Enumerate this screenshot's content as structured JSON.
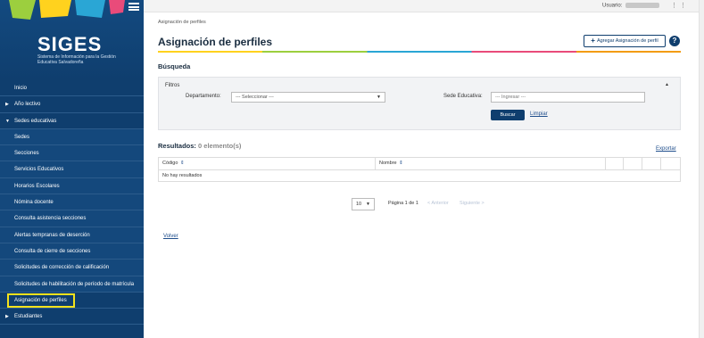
{
  "sidebar": {
    "logo_title": "SIGES",
    "logo_subtitle": "Sistema de Información para la Gestión Educativa Salvadoreña",
    "items": [
      {
        "label": "Inicio",
        "kind": "section",
        "arrow": ""
      },
      {
        "label": "Año lectivo",
        "kind": "section",
        "arrow": "▶"
      },
      {
        "label": "Sedes educativas",
        "kind": "section",
        "arrow": "▼"
      },
      {
        "label": "Sedes",
        "kind": "sub",
        "arrow": ""
      },
      {
        "label": "Secciones",
        "kind": "sub",
        "arrow": ""
      },
      {
        "label": "Servicios Educativos",
        "kind": "sub",
        "arrow": ""
      },
      {
        "label": "Horarios Escolares",
        "kind": "sub",
        "arrow": ""
      },
      {
        "label": "Nómina docente",
        "kind": "sub",
        "arrow": ""
      },
      {
        "label": "Consulta asistencia secciones",
        "kind": "sub",
        "arrow": ""
      },
      {
        "label": "Alertas tempranas de deserción",
        "kind": "sub",
        "arrow": ""
      },
      {
        "label": "Consulta de cierre de secciones",
        "kind": "sub",
        "arrow": ""
      },
      {
        "label": "Solicitudes de corrección de calificación",
        "kind": "sub",
        "arrow": ""
      },
      {
        "label": "Solicitudes de habilitación de período de matrícula",
        "kind": "sub",
        "arrow": ""
      },
      {
        "label": "Asignación de perfiles",
        "kind": "active",
        "arrow": ""
      },
      {
        "label": "Estudiantes",
        "kind": "section",
        "arrow": "▶"
      }
    ]
  },
  "topbar": {
    "user_label": "Usuario:",
    "menu_dots": "⋮"
  },
  "breadcrumb": "Asignación de perfiles",
  "page_title": "Asignación de perfiles",
  "add_button": {
    "icon": "+",
    "label": "Agregar Asignación de perfil"
  },
  "help_label": "?",
  "search": {
    "title": "Búsqueda",
    "filters_title": "Filtros",
    "collapse_caret": "▲",
    "department_label": "Departamento:",
    "department_value": "--- Seleccionar ---",
    "dropdown_arrow": "▼",
    "sede_label": "Sede Educativa:",
    "sede_placeholder": "--- Ingresar ---",
    "search_button": "Buscar",
    "clear_link": "Limpiar"
  },
  "results": {
    "label": "Resultados:",
    "count": "0 elemento(s)",
    "export_link": "Exportar",
    "columns": [
      {
        "label": "Código",
        "sort": "⇕"
      },
      {
        "label": "Nombre",
        "sort": "⇕"
      }
    ],
    "empty_message": "No hay resultados"
  },
  "pager": {
    "page_size": "10",
    "page_info": "Página 1 de 1",
    "prev": "< Anterior",
    "next": "Siguiente >"
  },
  "back_link": "Volver",
  "colors": {
    "sidebar_bg": "#0f3e6e",
    "highlight": "#f3e21c",
    "accent": "#1f4e8c"
  }
}
